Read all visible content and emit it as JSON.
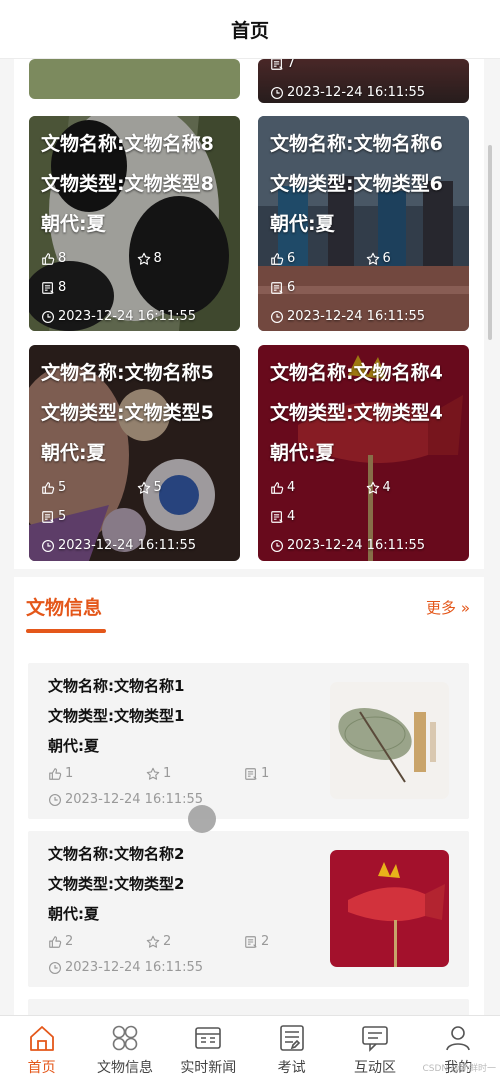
{
  "header": {
    "title": "首页"
  },
  "partial_top": {
    "stat": "7",
    "time": "2023-12-24 16:11:55"
  },
  "cards": [
    {
      "name": "文物名称:文物名称8",
      "type": "文物类型:文物类型8",
      "dynasty": "朝代:夏",
      "likes": "8",
      "favs": "8",
      "comments": "8",
      "time": "2023-12-24 16:11:55"
    },
    {
      "name": "文物名称:文物名称6",
      "type": "文物类型:文物类型6",
      "dynasty": "朝代:夏",
      "likes": "6",
      "favs": "6",
      "comments": "6",
      "time": "2023-12-24 16:11:55"
    },
    {
      "name": "文物名称:文物名称5",
      "type": "文物类型:文物类型5",
      "dynasty": "朝代:夏",
      "likes": "5",
      "favs": "5",
      "comments": "5",
      "time": "2023-12-24 16:11:55"
    },
    {
      "name": "文物名称:文物名称4",
      "type": "文物类型:文物类型4",
      "dynasty": "朝代:夏",
      "likes": "4",
      "favs": "4",
      "comments": "4",
      "time": "2023-12-24 16:11:55"
    }
  ],
  "section": {
    "title": "文物信息",
    "more": "更多 »"
  },
  "list": [
    {
      "name": "文物名称:文物名称1",
      "type": "文物类型:文物类型1",
      "dynasty": "朝代:夏",
      "likes": "1",
      "favs": "1",
      "comments": "1",
      "time": "2023-12-24 16:11:55"
    },
    {
      "name": "文物名称:文物名称2",
      "type": "文物类型:文物类型2",
      "dynasty": "朝代:夏",
      "likes": "2",
      "favs": "2",
      "comments": "2",
      "time": "2023-12-24 16:11:55"
    }
  ],
  "tabs": [
    {
      "label": "首页",
      "icon": "home-icon",
      "active": true
    },
    {
      "label": "文物信息",
      "icon": "grid-icon",
      "active": false
    },
    {
      "label": "实时新闻",
      "icon": "news-icon",
      "active": false
    },
    {
      "label": "考试",
      "icon": "exam-icon",
      "active": false
    },
    {
      "label": "互动区",
      "icon": "chat-icon",
      "active": false
    },
    {
      "label": "我的",
      "icon": "user-icon",
      "active": false
    }
  ],
  "watermark": "CSDN @新鲜时一",
  "colors": {
    "accent": "#e4571a"
  }
}
